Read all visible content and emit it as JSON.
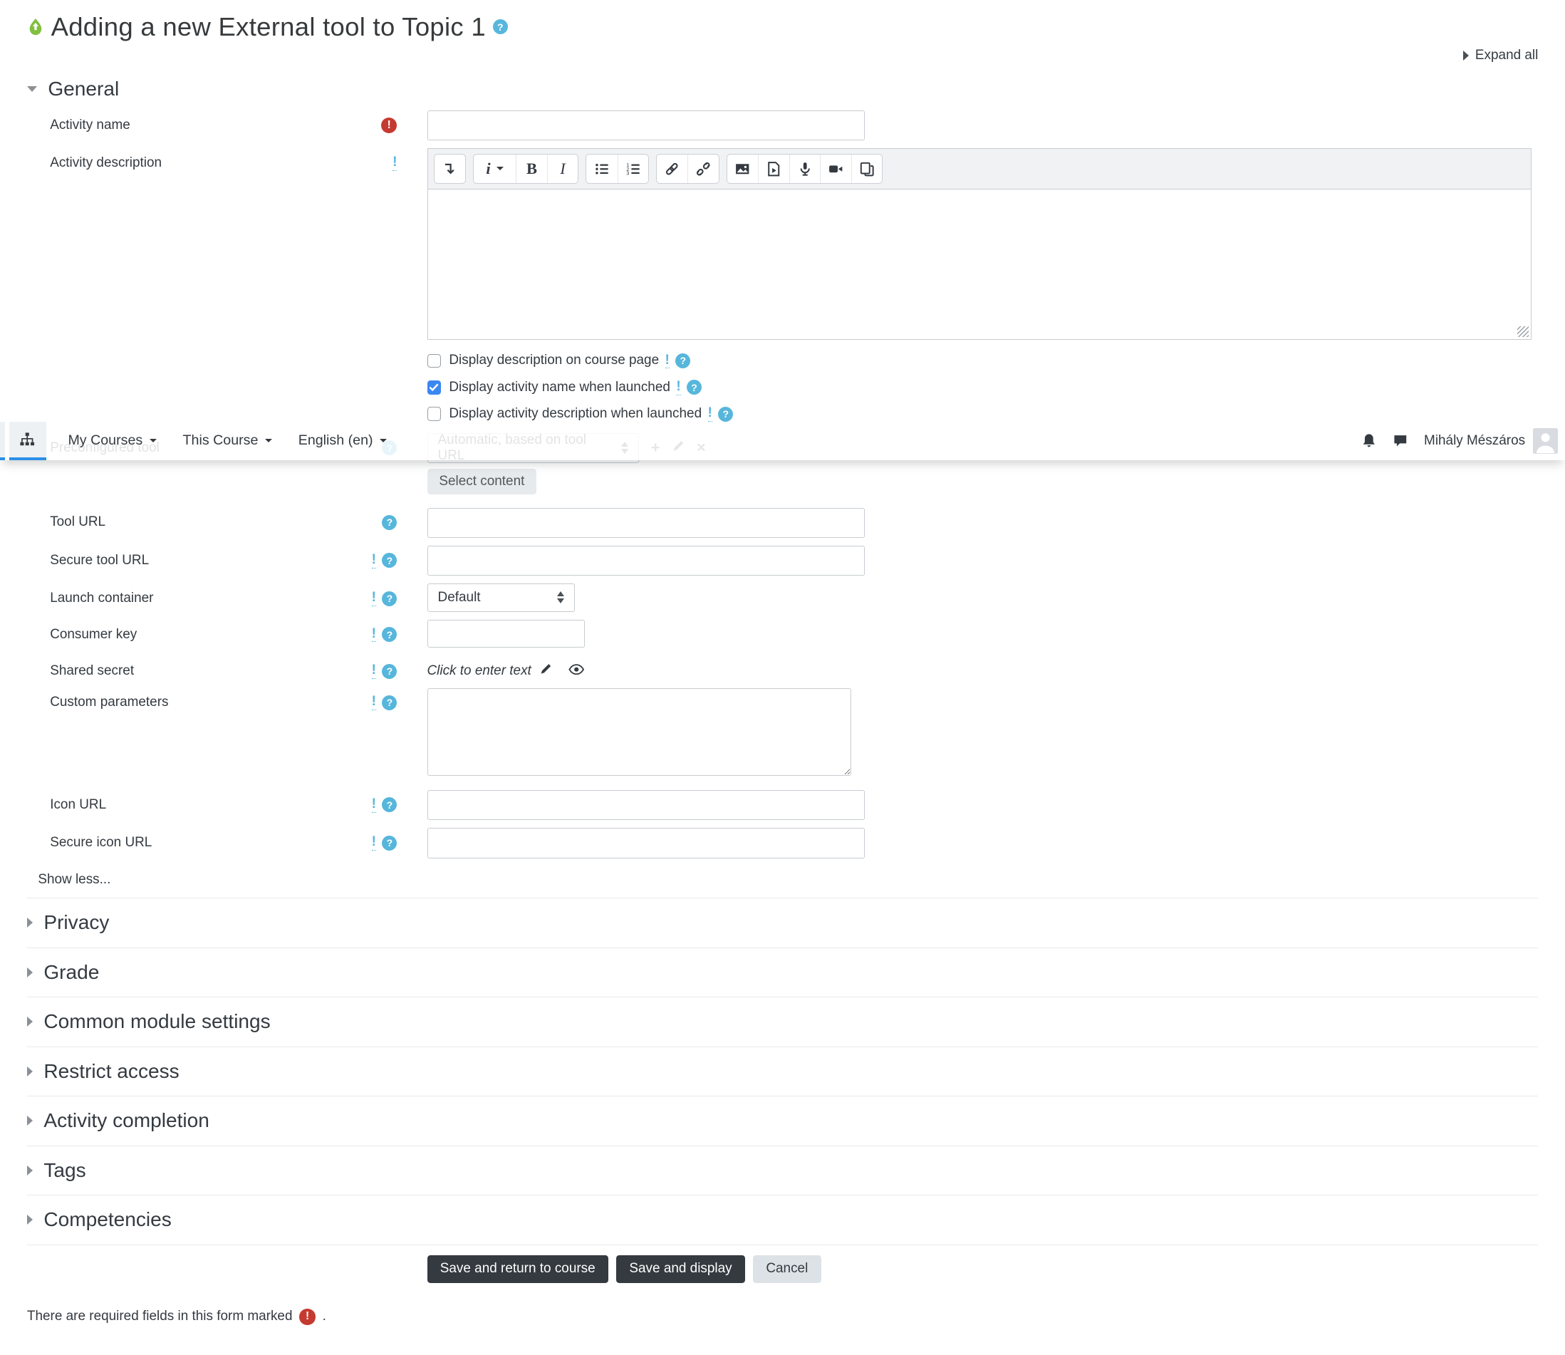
{
  "page": {
    "title": "Adding a new External tool to Topic 1",
    "expand_all": "Expand all",
    "required_note": "There are required fields in this form marked",
    "required_note_period": "."
  },
  "glyphs": {
    "help": "?",
    "warning": "!",
    "required": "!",
    "plus": "+",
    "close": "×"
  },
  "colors": {
    "help_blue": "#57b6db",
    "required_red": "#c53a30",
    "tool_green": "#82bf3e",
    "tab_underline_blue": "#2a8fe8",
    "checkbox_blue": "#3a87f2",
    "button_dark": "#343a40"
  },
  "navbar": {
    "items": [
      {
        "label": "My Courses"
      },
      {
        "label": "This Course"
      },
      {
        "label": "English (en)"
      }
    ],
    "user_name": "Mihály Mészáros",
    "icons": [
      "sitemap-icon",
      "bell-icon",
      "chat-icon",
      "avatar"
    ]
  },
  "general": {
    "heading": "General",
    "activity_name": {
      "label": "Activity name",
      "value": ""
    },
    "activity_description": {
      "label": "Activity description",
      "value": ""
    },
    "checkboxes": [
      {
        "label": "Display description on course page",
        "checked": false
      },
      {
        "label": "Display activity name when launched",
        "checked": true
      },
      {
        "label": "Display activity description when launched",
        "checked": false
      }
    ],
    "preconfigured_tool": {
      "label": "Preconfigured tool",
      "value": "Automatic, based on tool URL"
    },
    "select_content_button": "Select content",
    "tool_url": {
      "label": "Tool URL",
      "value": ""
    },
    "secure_tool_url": {
      "label": "Secure tool URL",
      "value": ""
    },
    "launch_container": {
      "label": "Launch container",
      "value": "Default"
    },
    "consumer_key": {
      "label": "Consumer key",
      "value": ""
    },
    "shared_secret": {
      "label": "Shared secret",
      "value": "Click to enter text"
    },
    "custom_parameters": {
      "label": "Custom parameters",
      "value": ""
    },
    "icon_url": {
      "label": "Icon URL",
      "value": ""
    },
    "secure_icon_url": {
      "label": "Secure icon URL",
      "value": ""
    },
    "show_less": "Show less..."
  },
  "editor": {
    "toolbar_icons": [
      "collapse-toolbar-icon",
      "paragraph-style-icon",
      "bold-icon",
      "italic-icon",
      "bulleted-list-icon",
      "numbered-list-icon",
      "link-icon",
      "unlink-icon",
      "image-icon",
      "media-icon",
      "record-audio-icon",
      "record-video-icon",
      "manage-files-icon"
    ],
    "style_letter": "i",
    "bold_letter": "B",
    "italic_letter": "I"
  },
  "sections": [
    {
      "label": "Privacy"
    },
    {
      "label": "Grade"
    },
    {
      "label": "Common module settings"
    },
    {
      "label": "Restrict access"
    },
    {
      "label": "Activity completion"
    },
    {
      "label": "Tags"
    },
    {
      "label": "Competencies"
    }
  ],
  "buttons": {
    "save_return": "Save and return to course",
    "save_display": "Save and display",
    "cancel": "Cancel"
  }
}
